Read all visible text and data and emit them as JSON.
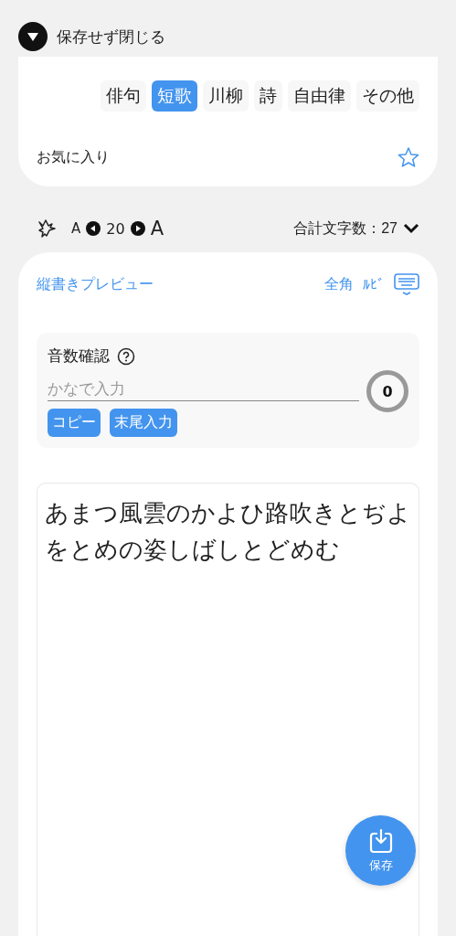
{
  "header": {
    "close_label": "保存せず閉じる"
  },
  "genres": [
    {
      "label": "俳句",
      "selected": false
    },
    {
      "label": "短歌",
      "selected": true
    },
    {
      "label": "川柳",
      "selected": false
    },
    {
      "label": "詩",
      "selected": false
    },
    {
      "label": "自由律",
      "selected": false
    },
    {
      "label": "その他",
      "selected": false
    }
  ],
  "favorite": {
    "label": "お気に入り",
    "on": false
  },
  "toolbar": {
    "small_a": "A",
    "font_size": "20",
    "large_a": "A",
    "total_count": "合計文字数：27"
  },
  "editor_header": {
    "vertical_preview": "縦書きプレビュー",
    "fullwidth": "全角",
    "ruby": "ﾙﾋﾞ"
  },
  "syllable_check": {
    "title": "音数確認",
    "placeholder": "かなで入力",
    "count": "0",
    "buttons": [
      "コピー",
      "末尾入力"
    ]
  },
  "body_text": "あまつ風雲のかよひ路吹きとぢよをとめの姿しばしとどめむ",
  "save_button": {
    "label": "保存"
  }
}
